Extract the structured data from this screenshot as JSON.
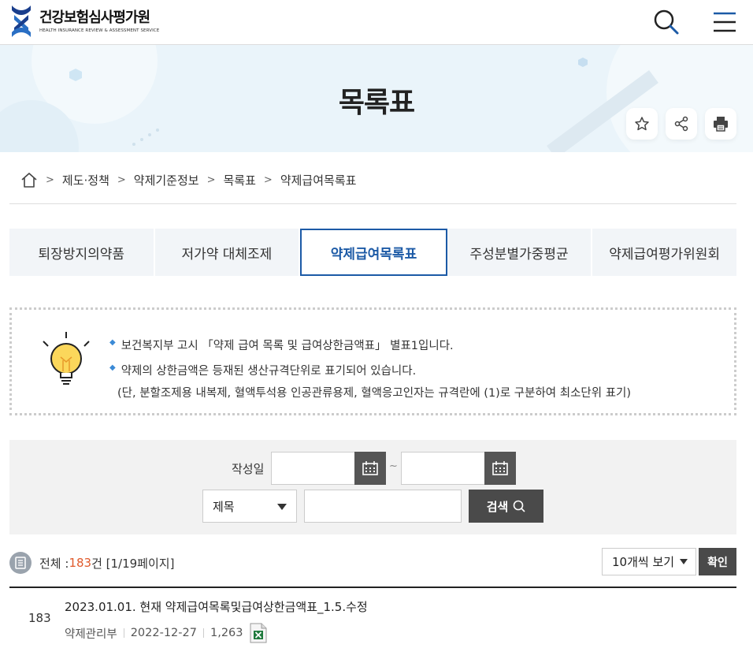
{
  "header": {
    "logo_ko": "건강보험심사평가원",
    "logo_en": "HEALTH INSURANCE REVIEW & ASSESSMENT SERVICE",
    "search_icon": "search-icon",
    "menu_icon": "hamburger-menu-icon"
  },
  "banner": {
    "title": "목록표",
    "tools": [
      "star-icon",
      "share-icon",
      "print-icon"
    ]
  },
  "breadcrumb": [
    "제도·정책",
    "약제기준정보",
    "목록표",
    "약제급여목록표"
  ],
  "tabs": [
    {
      "label": "퇴장방지의약품",
      "active": false
    },
    {
      "label": "저가약 대체조제",
      "active": false
    },
    {
      "label": "약제급여목록표",
      "active": true
    },
    {
      "label": "주성분별가중평균",
      "active": false
    },
    {
      "label": "약제급여평가위원회",
      "active": false
    }
  ],
  "notice": {
    "line1": "보건복지부 고시 「약제 급여 목록 및 급여상한금액표」 별표1입니다.",
    "line2": "약제의 상한금액은 등재된 생산규격단위로 표기되어 있습니다.",
    "line3": "(단, 분할조제용 내복제, 혈액투석용 인공관류용제, 혈액응고인자는 규격란에 (1)로 구분하여 최소단위 표기)"
  },
  "search": {
    "date_label": "작성일",
    "tilde": "~",
    "select_value": "제목",
    "button_label": "검색"
  },
  "list": {
    "total_label": "전체 : ",
    "total_count": "183",
    "total_suffix": "건 [1/19페이지]",
    "per_page": "10개씩 보기",
    "confirm_label": "확인",
    "items": [
      {
        "num": "183",
        "title": "2023.01.01. 현재 약제급여목록및급여상한금액표_1.5.수정",
        "dept": "약제관리부",
        "date": "2022-12-27",
        "views": "1,263"
      }
    ]
  },
  "colors": {
    "accent": "#1c5aa6",
    "count_highlight": "#e05a2b",
    "dark_button": "#4a4a4a"
  }
}
